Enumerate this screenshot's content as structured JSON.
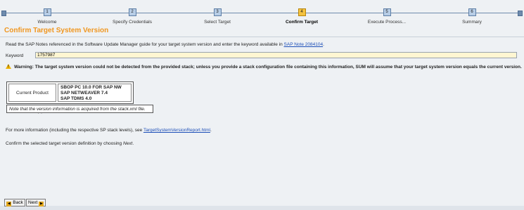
{
  "steps": [
    {
      "number": "1",
      "label": "Welcome"
    },
    {
      "number": "2",
      "label": "Specify Credentials"
    },
    {
      "number": "3",
      "label": "Select Target"
    },
    {
      "number": "4",
      "label": "Confirm Target"
    },
    {
      "number": "5",
      "label": "Execute Process..."
    },
    {
      "number": "6",
      "label": "Summary"
    }
  ],
  "active_step": 4,
  "page": {
    "title": "Confirm Target System Version",
    "intro_text": "Read the SAP Notes referenced in the Software Update Manager guide for your target system version and enter the keyword available in ",
    "intro_link": "SAP Note 2084104",
    "intro_end": ".",
    "keyword_label": "Keyword",
    "keyword_value": "1757987",
    "warning_icon": "warning-triangle-icon",
    "warning_text": "Warning: The target system version could not be detected from the provided stack; unless you provide a stack configuration file containing this information, SUM will assume that your target system version equals the current version.",
    "version_label": "Current Product Version(s)",
    "versions": [
      "SBOP PC 10.0 FOR SAP NW",
      "SAP NETWEAVER 7.4",
      "SAP TDMS 4.0"
    ],
    "version_note": "Note that the version information is acquired from the stack.xml file.",
    "more_info_text": "For more information (including the respective SP stack levels), see ",
    "more_info_link": "TargetSystemVersionReport.html",
    "more_info_end": ".",
    "confirm_text": "Confirm the selected target version definition by choosing ",
    "confirm_next": "Next",
    "confirm_end": "."
  },
  "buttons": {
    "back_label": "Back",
    "next_label": "Next",
    "back_icon": "left-arrow-icon",
    "next_icon": "right-arrow-icon"
  },
  "colors": {
    "title": "#f0961e",
    "active_step": "#f4c23f",
    "step": "#b7cde6",
    "link": "#1d4fb8",
    "keyword_field": "#fff6d2"
  }
}
